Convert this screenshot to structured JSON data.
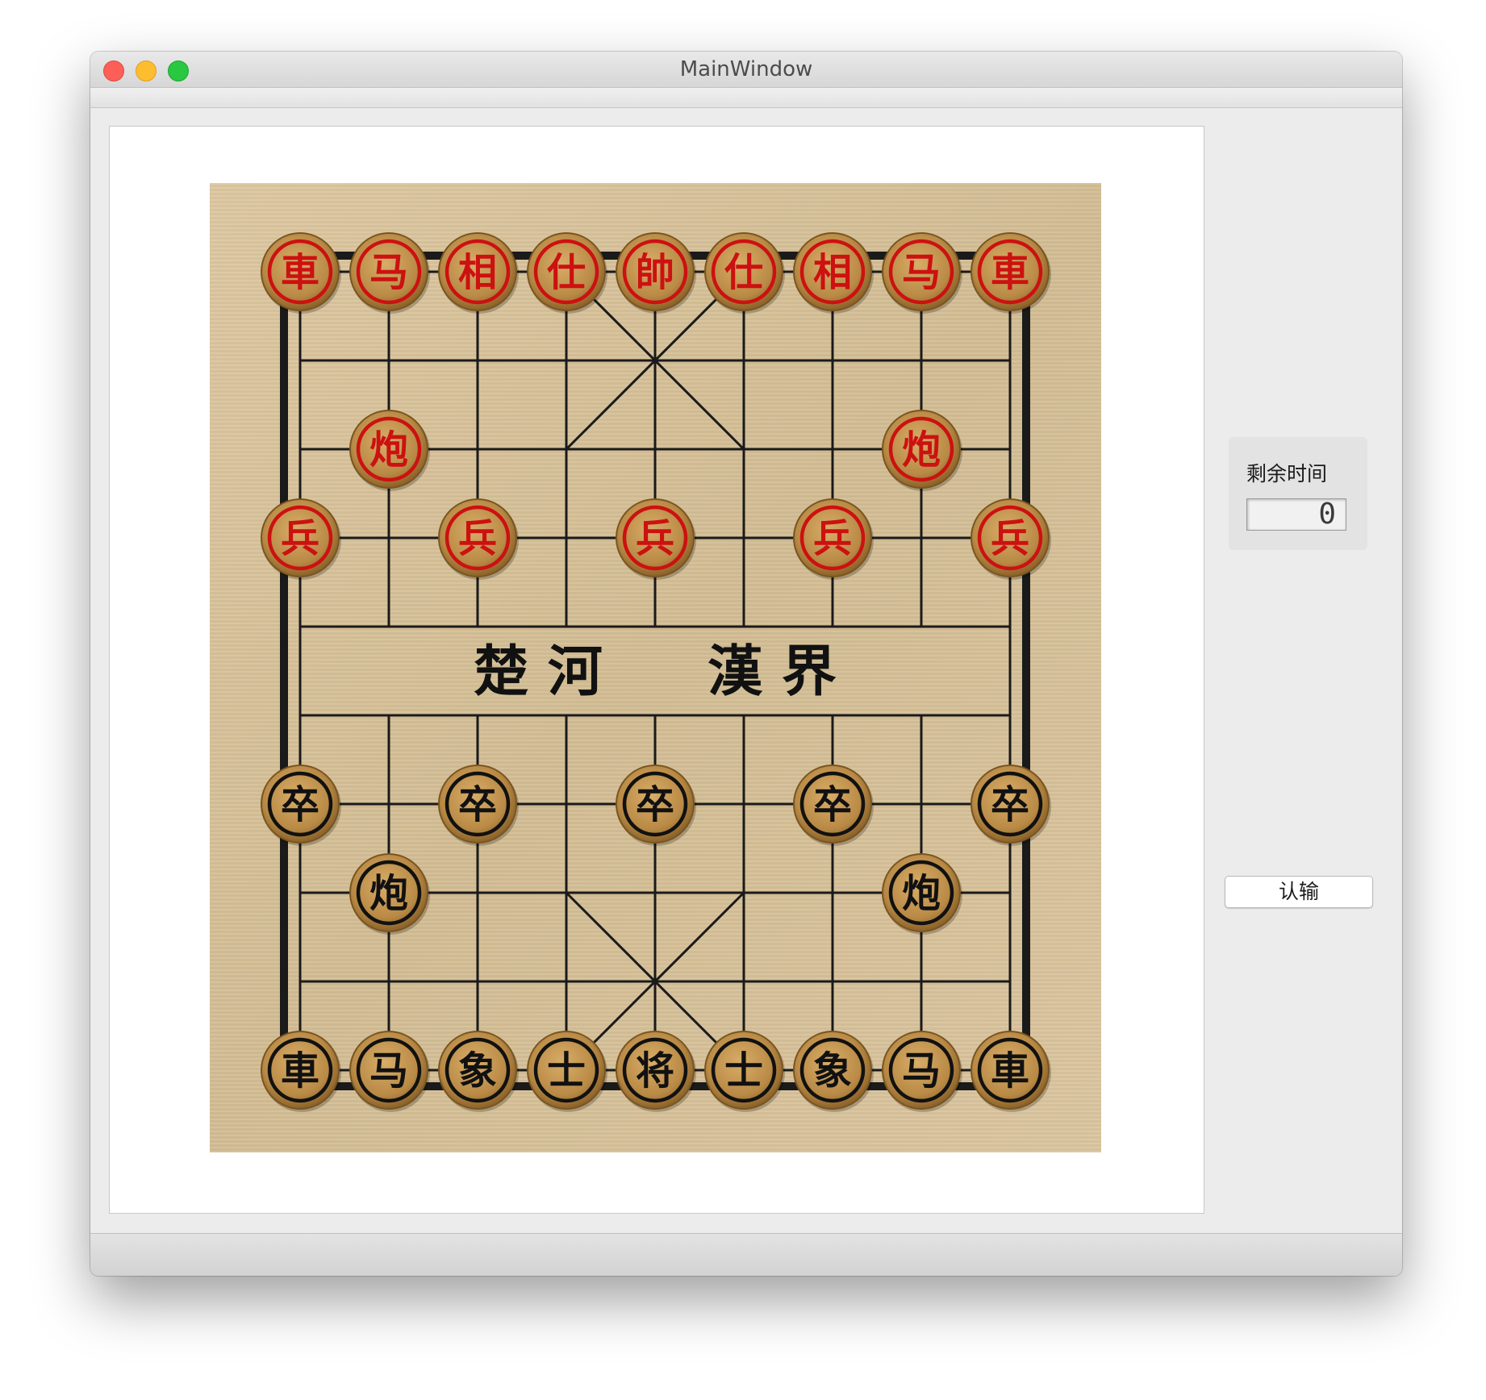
{
  "window": {
    "title": "MainWindow"
  },
  "board": {
    "river_left": "楚 河",
    "river_right": "漢 界",
    "colors": {
      "red": "#cc1111",
      "black": "#111111",
      "piece_wood": "#b98a45",
      "line": "#1a1a1a"
    },
    "pieces": [
      {
        "side": "red",
        "char": "車",
        "col": 0,
        "row": 0
      },
      {
        "side": "red",
        "char": "马",
        "col": 1,
        "row": 0
      },
      {
        "side": "red",
        "char": "相",
        "col": 2,
        "row": 0
      },
      {
        "side": "red",
        "char": "仕",
        "col": 3,
        "row": 0
      },
      {
        "side": "red",
        "char": "帥",
        "col": 4,
        "row": 0
      },
      {
        "side": "red",
        "char": "仕",
        "col": 5,
        "row": 0
      },
      {
        "side": "red",
        "char": "相",
        "col": 6,
        "row": 0
      },
      {
        "side": "red",
        "char": "马",
        "col": 7,
        "row": 0
      },
      {
        "side": "red",
        "char": "車",
        "col": 8,
        "row": 0
      },
      {
        "side": "red",
        "char": "炮",
        "col": 1,
        "row": 2
      },
      {
        "side": "red",
        "char": "炮",
        "col": 7,
        "row": 2
      },
      {
        "side": "red",
        "char": "兵",
        "col": 0,
        "row": 3
      },
      {
        "side": "red",
        "char": "兵",
        "col": 2,
        "row": 3
      },
      {
        "side": "red",
        "char": "兵",
        "col": 4,
        "row": 3
      },
      {
        "side": "red",
        "char": "兵",
        "col": 6,
        "row": 3
      },
      {
        "side": "red",
        "char": "兵",
        "col": 8,
        "row": 3
      },
      {
        "side": "black",
        "char": "卒",
        "col": 0,
        "row": 6
      },
      {
        "side": "black",
        "char": "卒",
        "col": 2,
        "row": 6
      },
      {
        "side": "black",
        "char": "卒",
        "col": 4,
        "row": 6
      },
      {
        "side": "black",
        "char": "卒",
        "col": 6,
        "row": 6
      },
      {
        "side": "black",
        "char": "卒",
        "col": 8,
        "row": 6
      },
      {
        "side": "black",
        "char": "炮",
        "col": 1,
        "row": 7
      },
      {
        "side": "black",
        "char": "炮",
        "col": 7,
        "row": 7
      },
      {
        "side": "black",
        "char": "車",
        "col": 0,
        "row": 9
      },
      {
        "side": "black",
        "char": "马",
        "col": 1,
        "row": 9
      },
      {
        "side": "black",
        "char": "象",
        "col": 2,
        "row": 9
      },
      {
        "side": "black",
        "char": "士",
        "col": 3,
        "row": 9
      },
      {
        "side": "black",
        "char": "将",
        "col": 4,
        "row": 9
      },
      {
        "side": "black",
        "char": "士",
        "col": 5,
        "row": 9
      },
      {
        "side": "black",
        "char": "象",
        "col": 6,
        "row": 9
      },
      {
        "side": "black",
        "char": "马",
        "col": 7,
        "row": 9
      },
      {
        "side": "black",
        "char": "車",
        "col": 8,
        "row": 9
      }
    ]
  },
  "side_panel": {
    "timer_label": "剩余时间",
    "timer_value": "0",
    "resign_label": "认输"
  }
}
